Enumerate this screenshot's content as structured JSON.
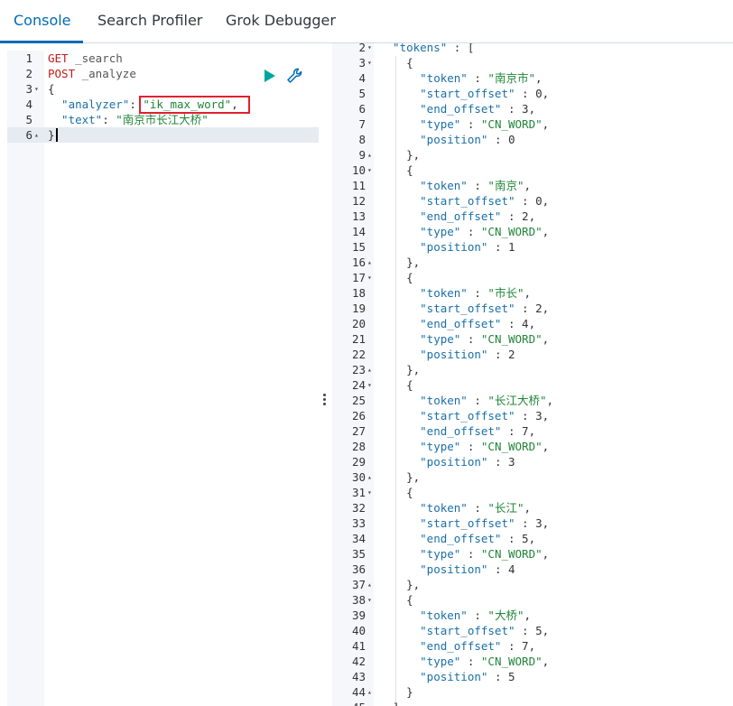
{
  "tabs": [
    {
      "label": "Console"
    },
    {
      "label": "Search Profiler"
    },
    {
      "label": "Grok Debugger"
    }
  ],
  "left_editor": {
    "lines": [
      {
        "n": "1",
        "tokens": [
          [
            "kw",
            "GET"
          ],
          [
            "path",
            " _search"
          ]
        ]
      },
      {
        "n": "2",
        "tokens": [
          [
            "kw",
            "POST"
          ],
          [
            "path",
            " _analyze"
          ]
        ]
      },
      {
        "n": "3",
        "tokens": [
          [
            "punc",
            "{"
          ]
        ]
      },
      {
        "n": "4",
        "tokens": [
          [
            "key",
            "  \"analyzer\""
          ],
          [
            "punc",
            ": "
          ],
          [
            "str",
            "\"ik_max_word\""
          ],
          [
            "punc",
            ","
          ]
        ]
      },
      {
        "n": "5",
        "tokens": [
          [
            "key",
            "  \"text\""
          ],
          [
            "punc",
            ": "
          ],
          [
            "str",
            "\"南京市长江大桥\""
          ]
        ]
      },
      {
        "n": "6",
        "tokens": [
          [
            "punc",
            "}"
          ]
        ]
      }
    ]
  },
  "right_editor": {
    "lines": [
      {
        "n": "2",
        "tokens": [
          [
            "key",
            "  \"tokens\""
          ],
          [
            "punc",
            " : ["
          ]
        ]
      },
      {
        "n": "3",
        "tokens": [
          [
            "punc",
            "    {"
          ]
        ]
      },
      {
        "n": "4",
        "tokens": [
          [
            "key",
            "      \"token\""
          ],
          [
            "punc",
            " : "
          ],
          [
            "str",
            "\"南京市\""
          ],
          [
            "punc",
            ","
          ]
        ]
      },
      {
        "n": "5",
        "tokens": [
          [
            "key",
            "      \"start_offset\""
          ],
          [
            "punc",
            " : "
          ],
          [
            "num",
            "0"
          ],
          [
            "punc",
            ","
          ]
        ]
      },
      {
        "n": "6",
        "tokens": [
          [
            "key",
            "      \"end_offset\""
          ],
          [
            "punc",
            " : "
          ],
          [
            "num",
            "3"
          ],
          [
            "punc",
            ","
          ]
        ]
      },
      {
        "n": "7",
        "tokens": [
          [
            "key",
            "      \"type\""
          ],
          [
            "punc",
            " : "
          ],
          [
            "str",
            "\"CN_WORD\""
          ],
          [
            "punc",
            ","
          ]
        ]
      },
      {
        "n": "8",
        "tokens": [
          [
            "key",
            "      \"position\""
          ],
          [
            "punc",
            " : "
          ],
          [
            "num",
            "0"
          ]
        ]
      },
      {
        "n": "9",
        "tokens": [
          [
            "punc",
            "    },"
          ]
        ]
      },
      {
        "n": "10",
        "tokens": [
          [
            "punc",
            "    {"
          ]
        ]
      },
      {
        "n": "11",
        "tokens": [
          [
            "key",
            "      \"token\""
          ],
          [
            "punc",
            " : "
          ],
          [
            "str",
            "\"南京\""
          ],
          [
            "punc",
            ","
          ]
        ]
      },
      {
        "n": "12",
        "tokens": [
          [
            "key",
            "      \"start_offset\""
          ],
          [
            "punc",
            " : "
          ],
          [
            "num",
            "0"
          ],
          [
            "punc",
            ","
          ]
        ]
      },
      {
        "n": "13",
        "tokens": [
          [
            "key",
            "      \"end_offset\""
          ],
          [
            "punc",
            " : "
          ],
          [
            "num",
            "2"
          ],
          [
            "punc",
            ","
          ]
        ]
      },
      {
        "n": "14",
        "tokens": [
          [
            "key",
            "      \"type\""
          ],
          [
            "punc",
            " : "
          ],
          [
            "str",
            "\"CN_WORD\""
          ],
          [
            "punc",
            ","
          ]
        ]
      },
      {
        "n": "15",
        "tokens": [
          [
            "key",
            "      \"position\""
          ],
          [
            "punc",
            " : "
          ],
          [
            "num",
            "1"
          ]
        ]
      },
      {
        "n": "16",
        "tokens": [
          [
            "punc",
            "    },"
          ]
        ]
      },
      {
        "n": "17",
        "tokens": [
          [
            "punc",
            "    {"
          ]
        ]
      },
      {
        "n": "18",
        "tokens": [
          [
            "key",
            "      \"token\""
          ],
          [
            "punc",
            " : "
          ],
          [
            "str",
            "\"市长\""
          ],
          [
            "punc",
            ","
          ]
        ]
      },
      {
        "n": "19",
        "tokens": [
          [
            "key",
            "      \"start_offset\""
          ],
          [
            "punc",
            " : "
          ],
          [
            "num",
            "2"
          ],
          [
            "punc",
            ","
          ]
        ]
      },
      {
        "n": "20",
        "tokens": [
          [
            "key",
            "      \"end_offset\""
          ],
          [
            "punc",
            " : "
          ],
          [
            "num",
            "4"
          ],
          [
            "punc",
            ","
          ]
        ]
      },
      {
        "n": "21",
        "tokens": [
          [
            "key",
            "      \"type\""
          ],
          [
            "punc",
            " : "
          ],
          [
            "str",
            "\"CN_WORD\""
          ],
          [
            "punc",
            ","
          ]
        ]
      },
      {
        "n": "22",
        "tokens": [
          [
            "key",
            "      \"position\""
          ],
          [
            "punc",
            " : "
          ],
          [
            "num",
            "2"
          ]
        ]
      },
      {
        "n": "23",
        "tokens": [
          [
            "punc",
            "    },"
          ]
        ]
      },
      {
        "n": "24",
        "tokens": [
          [
            "punc",
            "    {"
          ]
        ]
      },
      {
        "n": "25",
        "tokens": [
          [
            "key",
            "      \"token\""
          ],
          [
            "punc",
            " : "
          ],
          [
            "str",
            "\"长江大桥\""
          ],
          [
            "punc",
            ","
          ]
        ]
      },
      {
        "n": "26",
        "tokens": [
          [
            "key",
            "      \"start_offset\""
          ],
          [
            "punc",
            " : "
          ],
          [
            "num",
            "3"
          ],
          [
            "punc",
            ","
          ]
        ]
      },
      {
        "n": "27",
        "tokens": [
          [
            "key",
            "      \"end_offset\""
          ],
          [
            "punc",
            " : "
          ],
          [
            "num",
            "7"
          ],
          [
            "punc",
            ","
          ]
        ]
      },
      {
        "n": "28",
        "tokens": [
          [
            "key",
            "      \"type\""
          ],
          [
            "punc",
            " : "
          ],
          [
            "str",
            "\"CN_WORD\""
          ],
          [
            "punc",
            ","
          ]
        ]
      },
      {
        "n": "29",
        "tokens": [
          [
            "key",
            "      \"position\""
          ],
          [
            "punc",
            " : "
          ],
          [
            "num",
            "3"
          ]
        ]
      },
      {
        "n": "30",
        "tokens": [
          [
            "punc",
            "    },"
          ]
        ]
      },
      {
        "n": "31",
        "tokens": [
          [
            "punc",
            "    {"
          ]
        ]
      },
      {
        "n": "32",
        "tokens": [
          [
            "key",
            "      \"token\""
          ],
          [
            "punc",
            " : "
          ],
          [
            "str",
            "\"长江\""
          ],
          [
            "punc",
            ","
          ]
        ]
      },
      {
        "n": "33",
        "tokens": [
          [
            "key",
            "      \"start_offset\""
          ],
          [
            "punc",
            " : "
          ],
          [
            "num",
            "3"
          ],
          [
            "punc",
            ","
          ]
        ]
      },
      {
        "n": "34",
        "tokens": [
          [
            "key",
            "      \"end_offset\""
          ],
          [
            "punc",
            " : "
          ],
          [
            "num",
            "5"
          ],
          [
            "punc",
            ","
          ]
        ]
      },
      {
        "n": "35",
        "tokens": [
          [
            "key",
            "      \"type\""
          ],
          [
            "punc",
            " : "
          ],
          [
            "str",
            "\"CN_WORD\""
          ],
          [
            "punc",
            ","
          ]
        ]
      },
      {
        "n": "36",
        "tokens": [
          [
            "key",
            "      \"position\""
          ],
          [
            "punc",
            " : "
          ],
          [
            "num",
            "4"
          ]
        ]
      },
      {
        "n": "37",
        "tokens": [
          [
            "punc",
            "    },"
          ]
        ]
      },
      {
        "n": "38",
        "tokens": [
          [
            "punc",
            "    {"
          ]
        ]
      },
      {
        "n": "39",
        "tokens": [
          [
            "key",
            "      \"token\""
          ],
          [
            "punc",
            " : "
          ],
          [
            "str",
            "\"大桥\""
          ],
          [
            "punc",
            ","
          ]
        ]
      },
      {
        "n": "40",
        "tokens": [
          [
            "key",
            "      \"start_offset\""
          ],
          [
            "punc",
            " : "
          ],
          [
            "num",
            "5"
          ],
          [
            "punc",
            ","
          ]
        ]
      },
      {
        "n": "41",
        "tokens": [
          [
            "key",
            "      \"end_offset\""
          ],
          [
            "punc",
            " : "
          ],
          [
            "num",
            "7"
          ],
          [
            "punc",
            ","
          ]
        ]
      },
      {
        "n": "42",
        "tokens": [
          [
            "key",
            "      \"type\""
          ],
          [
            "punc",
            " : "
          ],
          [
            "str",
            "\"CN_WORD\""
          ],
          [
            "punc",
            ","
          ]
        ]
      },
      {
        "n": "43",
        "tokens": [
          [
            "key",
            "      \"position\""
          ],
          [
            "punc",
            " : "
          ],
          [
            "num",
            "5"
          ]
        ]
      },
      {
        "n": "44",
        "tokens": [
          [
            "punc",
            "    }"
          ]
        ]
      },
      {
        "n": "45",
        "tokens": [
          [
            "punc",
            "  ]"
          ]
        ]
      }
    ]
  },
  "icons": {
    "play": "play-icon",
    "wrench": "wrench-icon",
    "resizer": "resize-handle-icon"
  },
  "colors": {
    "accent": "#006bb4",
    "method": "#c41a16",
    "string": "#22863a",
    "key": "#1a6fa8",
    "highlight": "#e0212e",
    "run": "#00a69b"
  }
}
